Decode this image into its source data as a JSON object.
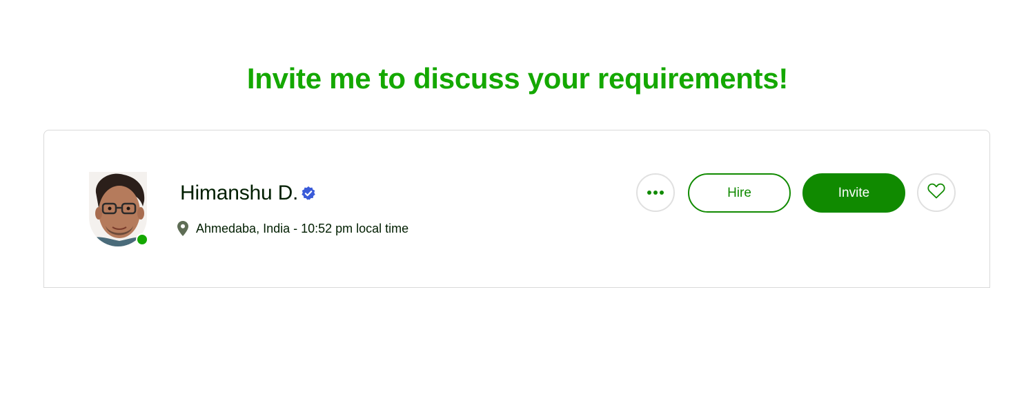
{
  "headline": "Invite me to discuss your requirements!",
  "profile": {
    "name": "Himanshu D.",
    "location": "Ahmedaba, India - 10:52 pm local time",
    "online": true
  },
  "actions": {
    "more_label": "More options",
    "hire_label": "Hire",
    "invite_label": "Invite",
    "favorite_label": "Save"
  },
  "icons": {
    "verified": "verified-badge-icon",
    "location": "map-pin-icon",
    "more": "ellipsis-icon",
    "favorite": "heart-icon"
  },
  "colors": {
    "brand_green": "#14a800",
    "button_green": "#108a00",
    "verified_blue": "#3a5bd9",
    "text_dark": "#001e00"
  }
}
